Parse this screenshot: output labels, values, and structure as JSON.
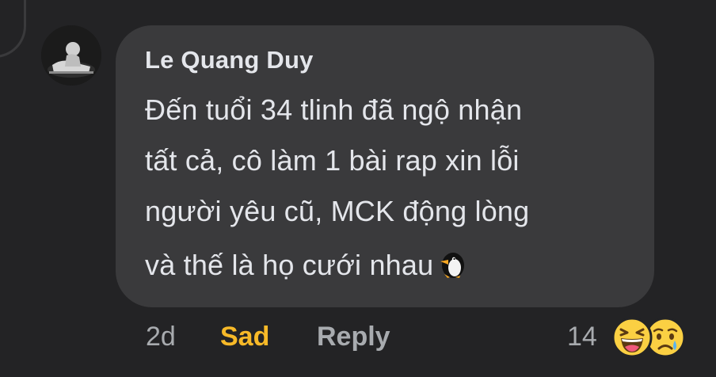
{
  "comment": {
    "author": "Le Quang Duy",
    "text_lines": [
      "Đến tuổi 34 tlinh đã ngộ nhận",
      "tất cả, cô làm 1 bài rap xin lỗi",
      "người yêu cũ, MCK động lòng",
      "và thế là họ cưới nhau"
    ],
    "inline_emoji": "penguin-emoji"
  },
  "actions": {
    "time": "2d",
    "user_reaction": "Sad",
    "reply": "Reply",
    "reaction_count": "14",
    "reaction_icons": [
      "haha-emoji",
      "sad-emoji"
    ]
  },
  "colors": {
    "background": "#232325",
    "bubble": "#3a3a3c",
    "text": "#e4e6eb",
    "muted": "#a8abaf",
    "sad_accent": "#f7b928"
  }
}
